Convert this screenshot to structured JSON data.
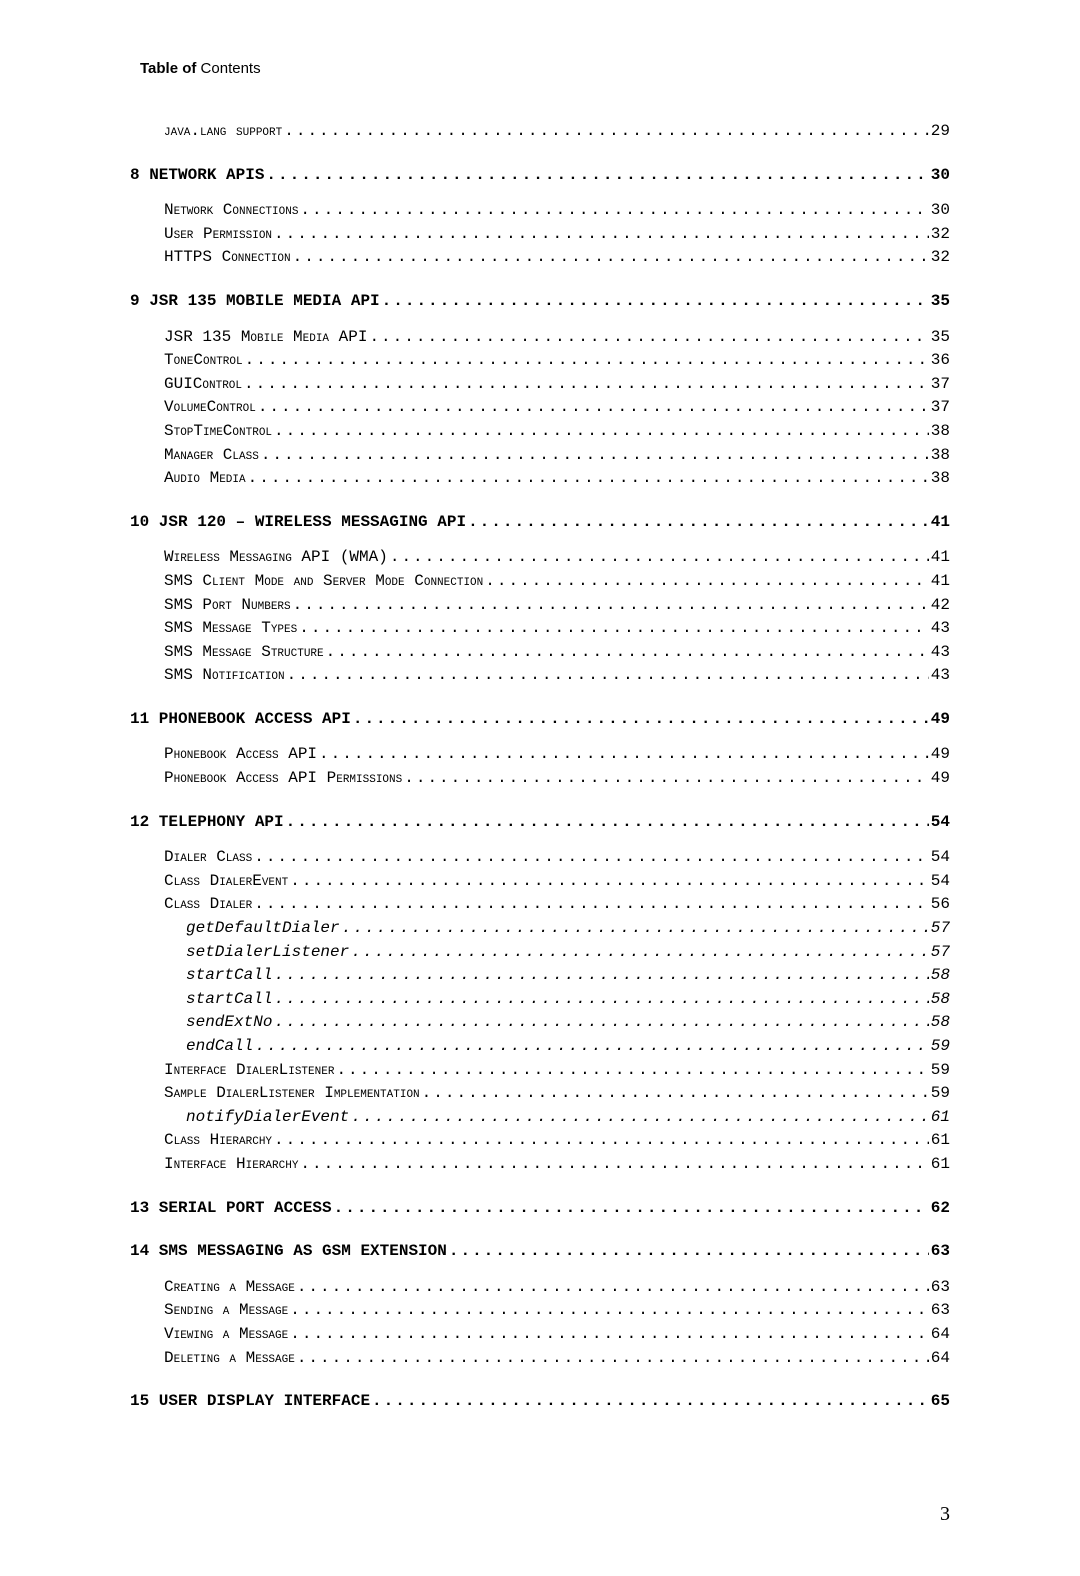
{
  "header": {
    "bold": "Table of",
    "light": " Contents"
  },
  "pageNumber": "3",
  "entries": [
    {
      "level": "section",
      "title": "java.lang support",
      "page": "29",
      "smallcaps": false
    },
    {
      "level": "chapter",
      "title": "8 NETWORK APIS",
      "page": "30"
    },
    {
      "level": "section",
      "title": "Network Connections",
      "page": "30"
    },
    {
      "level": "section",
      "title": "User Permission",
      "page": "32"
    },
    {
      "level": "section",
      "title": "HTTPS Connection",
      "page": "32"
    },
    {
      "level": "chapter",
      "title": "9 JSR 135 MOBILE MEDIA API",
      "page": "35"
    },
    {
      "level": "section",
      "title": "JSR 135 Mobile Media API",
      "page": "35"
    },
    {
      "level": "section",
      "title": "ToneControl",
      "page": "36"
    },
    {
      "level": "section",
      "title": "GUIControl",
      "page": "37"
    },
    {
      "level": "section",
      "title": "VolumeControl",
      "page": "37"
    },
    {
      "level": "section",
      "title": "StopTimeControl",
      "page": "38"
    },
    {
      "level": "section",
      "title": "Manager Class",
      "page": "38"
    },
    {
      "level": "section",
      "title": "Audio Media",
      "page": "38"
    },
    {
      "level": "chapter",
      "title": "10 JSR 120 – WIRELESS MESSAGING API",
      "page": "41"
    },
    {
      "level": "section",
      "title": "Wireless Messaging API (WMA)",
      "page": "41"
    },
    {
      "level": "section",
      "title": "SMS Client Mode and Server Mode Connection",
      "page": "41"
    },
    {
      "level": "section",
      "title": "SMS Port Numbers",
      "page": "42"
    },
    {
      "level": "section",
      "title": "SMS Message Types",
      "page": "43"
    },
    {
      "level": "section",
      "title": "SMS Message Structure",
      "page": "43"
    },
    {
      "level": "section",
      "title": "SMS Notification",
      "page": "43"
    },
    {
      "level": "chapter",
      "title": "11 PHONEBOOK ACCESS API",
      "page": "49"
    },
    {
      "level": "section",
      "title": "Phonebook Access API",
      "page": "49"
    },
    {
      "level": "section",
      "title": "Phonebook Access API Permissions",
      "page": "49"
    },
    {
      "level": "chapter",
      "title": "12 TELEPHONY API",
      "page": "54"
    },
    {
      "level": "section",
      "title": "Dialer Class",
      "page": "54"
    },
    {
      "level": "section",
      "title": "Class DialerEvent",
      "page": "54"
    },
    {
      "level": "section",
      "title": "Class Dialer",
      "page": "56"
    },
    {
      "level": "sub",
      "title": "getDefaultDialer",
      "page": "57"
    },
    {
      "level": "sub",
      "title": "setDialerListener",
      "page": "57"
    },
    {
      "level": "sub",
      "title": "startCall",
      "page": "58"
    },
    {
      "level": "sub",
      "title": "startCall",
      "page": "58"
    },
    {
      "level": "sub",
      "title": "sendExtNo",
      "page": "58"
    },
    {
      "level": "sub",
      "title": "endCall",
      "page": "59"
    },
    {
      "level": "section",
      "title": "Interface DialerListener",
      "page": "59"
    },
    {
      "level": "section",
      "title": "Sample DialerListener Implementation",
      "page": "59"
    },
    {
      "level": "sub",
      "title": "notifyDialerEvent",
      "page": "61"
    },
    {
      "level": "section",
      "title": "Class Hierarchy",
      "page": "61"
    },
    {
      "level": "section",
      "title": "Interface Hierarchy",
      "page": "61"
    },
    {
      "level": "chapter",
      "title": "13 SERIAL PORT ACCESS",
      "page": "62"
    },
    {
      "level": "chapter",
      "title": "14 SMS MESSAGING AS GSM EXTENSION",
      "page": "63"
    },
    {
      "level": "section",
      "title": "Creating a Message",
      "page": "63"
    },
    {
      "level": "section",
      "title": "Sending a Message",
      "page": "63"
    },
    {
      "level": "section",
      "title": "Viewing a Message",
      "page": "64"
    },
    {
      "level": "section",
      "title": "Deleting a Message",
      "page": "64"
    },
    {
      "level": "chapter",
      "title": "15 USER DISPLAY INTERFACE",
      "page": "65"
    }
  ]
}
